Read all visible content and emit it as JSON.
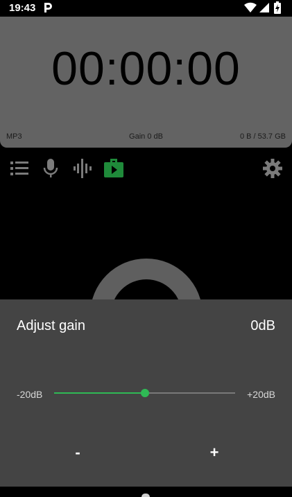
{
  "status_bar": {
    "time": "19:43",
    "icons": [
      "p-notification-icon",
      "wifi-icon",
      "signal-icon",
      "battery-charging-icon"
    ]
  },
  "timer": {
    "display": "00:00:00",
    "format": "MP3",
    "gain": "Gain 0 dB",
    "storage": "0 B / 53.7 GB"
  },
  "toolbar": {
    "icons": [
      "list-icon",
      "microphone-icon",
      "waveform-icon",
      "play-folder-icon",
      "gear-icon"
    ],
    "active_color": "#1f8a3a"
  },
  "gain_dialog": {
    "title": "Adjust gain",
    "value": "0dB",
    "min_label": "-20dB",
    "max_label": "+20dB",
    "slider_fraction": 0.5,
    "minus_label": "-",
    "plus_label": "+",
    "accent_color": "#2fba55"
  }
}
